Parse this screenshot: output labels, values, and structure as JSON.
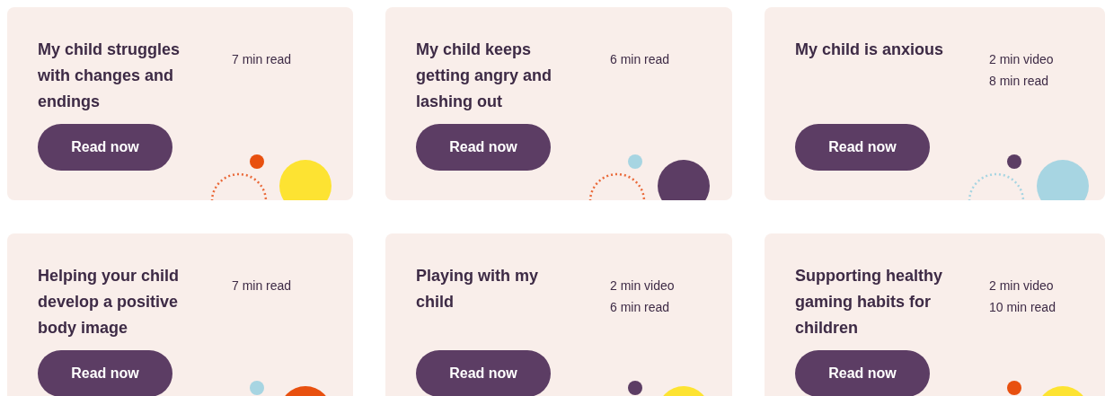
{
  "cards": [
    {
      "title": "My child struggles with changes and endings",
      "meta": [
        "7 min read"
      ],
      "button": "Read now",
      "decorations": [
        {
          "kind": "arc",
          "color": "#ea6a3a"
        },
        {
          "kind": "dot",
          "color": "#e8500f"
        },
        {
          "kind": "circle",
          "color": "#fde332"
        }
      ]
    },
    {
      "title": "My child keeps getting angry and lashing out",
      "meta": [
        "6 min read"
      ],
      "button": "Read now",
      "decorations": [
        {
          "kind": "arc",
          "color": "#ea6a3a"
        },
        {
          "kind": "dot",
          "color": "#a7d5e2"
        },
        {
          "kind": "circle",
          "color": "#5c3d64"
        }
      ]
    },
    {
      "title": "My child is anxious",
      "meta": [
        "2 min video",
        "8 min read"
      ],
      "button": "Read now",
      "decorations": [
        {
          "kind": "arc",
          "color": "#a7d5e2"
        },
        {
          "kind": "dot",
          "color": "#5c3d64"
        },
        {
          "kind": "circle",
          "color": "#a7d5e2"
        }
      ]
    },
    {
      "title": "Helping your child develop a positive body image",
      "meta": [
        "7 min read"
      ],
      "button": "Read now",
      "decorations": [
        {
          "kind": "dot",
          "color": "#a7d5e2"
        },
        {
          "kind": "circle",
          "color": "#e8500f"
        }
      ]
    },
    {
      "title": "Playing with my child",
      "meta": [
        "2 min video",
        "6 min read"
      ],
      "button": "Read now",
      "decorations": [
        {
          "kind": "dot",
          "color": "#5c3d64"
        },
        {
          "kind": "circle",
          "color": "#fde332"
        }
      ]
    },
    {
      "title": "Supporting healthy gaming habits for children",
      "meta": [
        "2 min video",
        "10 min read"
      ],
      "button": "Read now",
      "decorations": [
        {
          "kind": "dot",
          "color": "#e8500f"
        },
        {
          "kind": "circle",
          "color": "#fde332"
        }
      ]
    }
  ]
}
